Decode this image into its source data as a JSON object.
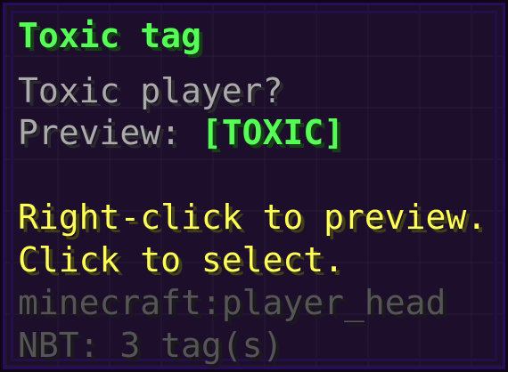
{
  "tooltip": {
    "title": "Toxic tag",
    "question": "Toxic player?",
    "preview_label": "Preview: ",
    "preview_value": "[TOXIC]",
    "hint_right_click": "Right-click to preview.",
    "hint_click": "Click to select.",
    "item_id": "minecraft:player_head",
    "nbt": "NBT: 3 tag(s)"
  },
  "colors": {
    "title": "#55ff55",
    "gray_text": "#aaaaaa",
    "preview_tag": "#55ff55",
    "hint": "#ffff55",
    "meta": "#555555",
    "background": "#1d0f2c",
    "border": "#2a0c5e"
  }
}
